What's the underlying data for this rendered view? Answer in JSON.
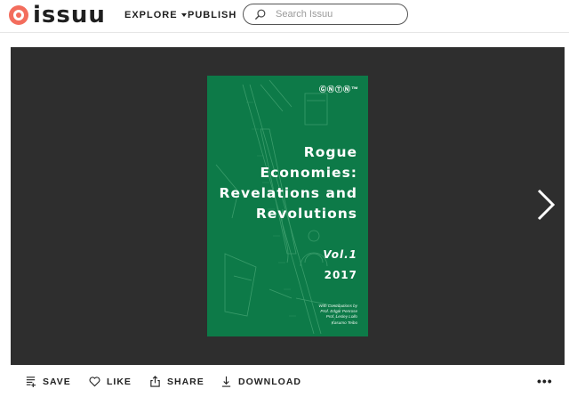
{
  "header": {
    "logo_text": "issuu",
    "nav": {
      "explore": "EXPLORE",
      "publish": "PUBLISH"
    },
    "search": {
      "placeholder": "Search Issuu",
      "value": ""
    }
  },
  "viewer": {
    "cover": {
      "logo": "ⒼⓃⓉⓃ™",
      "title_lines": [
        "Rogue",
        "Economies:",
        "Revelations and",
        "Revolutions"
      ],
      "volume": "Vol.1",
      "year": "2017",
      "credits": [
        "With Contributions by",
        "Prof. Edgar Penrose",
        "Prof. Lesley Lollo",
        "Kasumo Teibo"
      ],
      "background_color": "#0d7a48"
    },
    "next_icon": "chevron-right-icon"
  },
  "actions": {
    "save": "SAVE",
    "like": "LIKE",
    "share": "SHARE",
    "download": "DOWNLOAD",
    "more": "•••"
  },
  "colors": {
    "brand": "#f36d5d",
    "viewer_bg": "#2e2e2e"
  }
}
